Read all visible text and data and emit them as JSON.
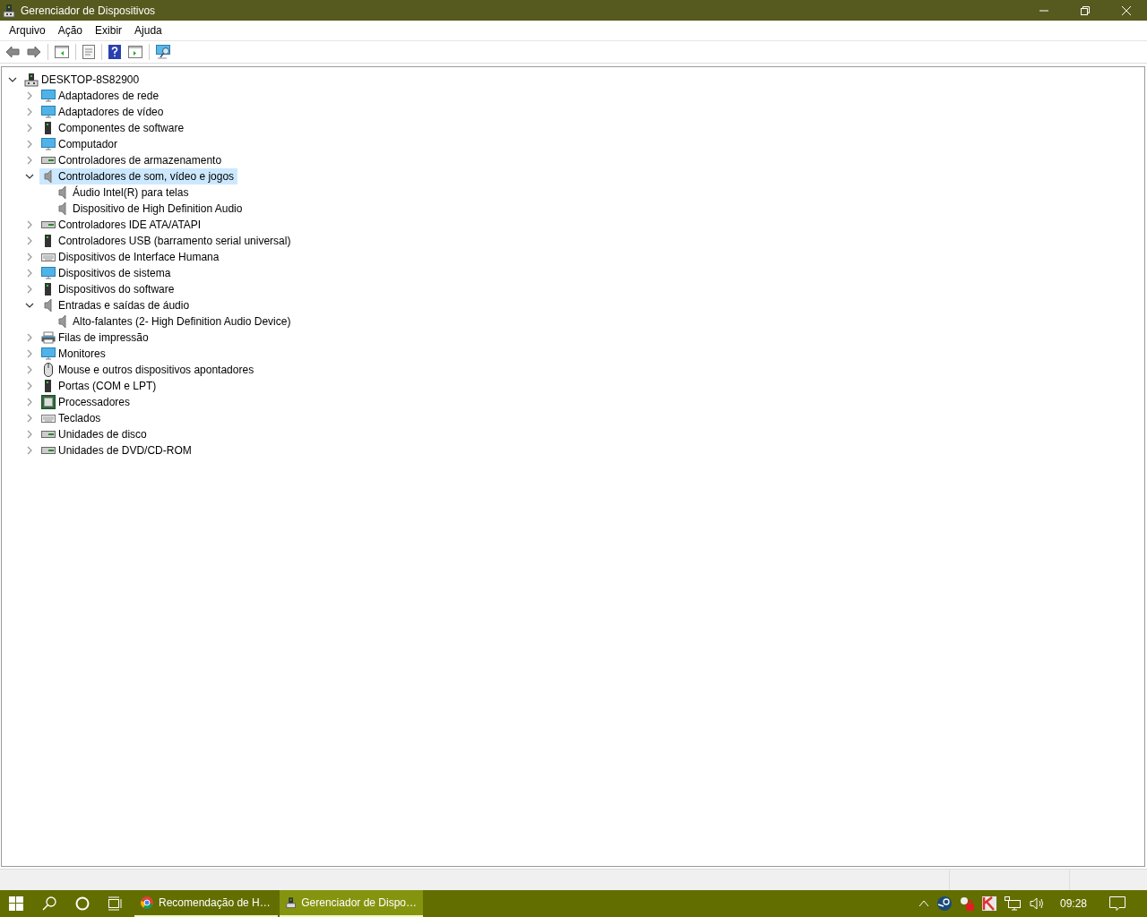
{
  "window": {
    "title": "Gerenciador de Dispositivos"
  },
  "menu": [
    {
      "label": "Arquivo"
    },
    {
      "label": "Ação"
    },
    {
      "label": "Exibir"
    },
    {
      "label": "Ajuda"
    }
  ],
  "tree": {
    "label": "DESKTOP-8S82900",
    "expanded": true,
    "children": [
      {
        "label": "Adaptadores de rede",
        "expanded": false,
        "selected": false
      },
      {
        "label": "Adaptadores de vídeo",
        "expanded": false,
        "selected": false
      },
      {
        "label": "Componentes de software",
        "expanded": false,
        "selected": false
      },
      {
        "label": "Computador",
        "expanded": false,
        "selected": false
      },
      {
        "label": "Controladores de armazenamento",
        "expanded": false,
        "selected": false
      },
      {
        "label": "Controladores de som, vídeo e jogos",
        "expanded": true,
        "selected": true,
        "children": [
          {
            "label": "Áudio Intel(R) para telas",
            "selected": false
          },
          {
            "label": "Dispositivo de High Definition Audio",
            "selected": false
          }
        ]
      },
      {
        "label": "Controladores IDE ATA/ATAPI",
        "expanded": false,
        "selected": false
      },
      {
        "label": "Controladores USB (barramento serial universal)",
        "expanded": false,
        "selected": false
      },
      {
        "label": "Dispositivos de Interface Humana",
        "expanded": false,
        "selected": false
      },
      {
        "label": "Dispositivos de sistema",
        "expanded": false,
        "selected": false
      },
      {
        "label": "Dispositivos do software",
        "expanded": false,
        "selected": false
      },
      {
        "label": "Entradas e saídas de áudio",
        "expanded": true,
        "selected": false,
        "children": [
          {
            "label": "Alto-falantes (2- High Definition Audio Device)",
            "selected": false
          }
        ]
      },
      {
        "label": "Filas de impressão",
        "expanded": false,
        "selected": false
      },
      {
        "label": "Monitores",
        "expanded": false,
        "selected": false
      },
      {
        "label": "Mouse e outros dispositivos apontadores",
        "expanded": false,
        "selected": false
      },
      {
        "label": "Portas (COM e LPT)",
        "expanded": false,
        "selected": false
      },
      {
        "label": "Processadores",
        "expanded": false,
        "selected": false
      },
      {
        "label": "Teclados",
        "expanded": false,
        "selected": false
      },
      {
        "label": "Unidades de disco",
        "expanded": false,
        "selected": false
      },
      {
        "label": "Unidades de DVD/CD-ROM",
        "expanded": false,
        "selected": false
      }
    ]
  },
  "taskbar": {
    "windows": [
      {
        "label": "Recomendação de H…",
        "selected": false
      },
      {
        "label": "Gerenciador de Dispo…",
        "selected": true
      }
    ],
    "clock": "09:28"
  }
}
